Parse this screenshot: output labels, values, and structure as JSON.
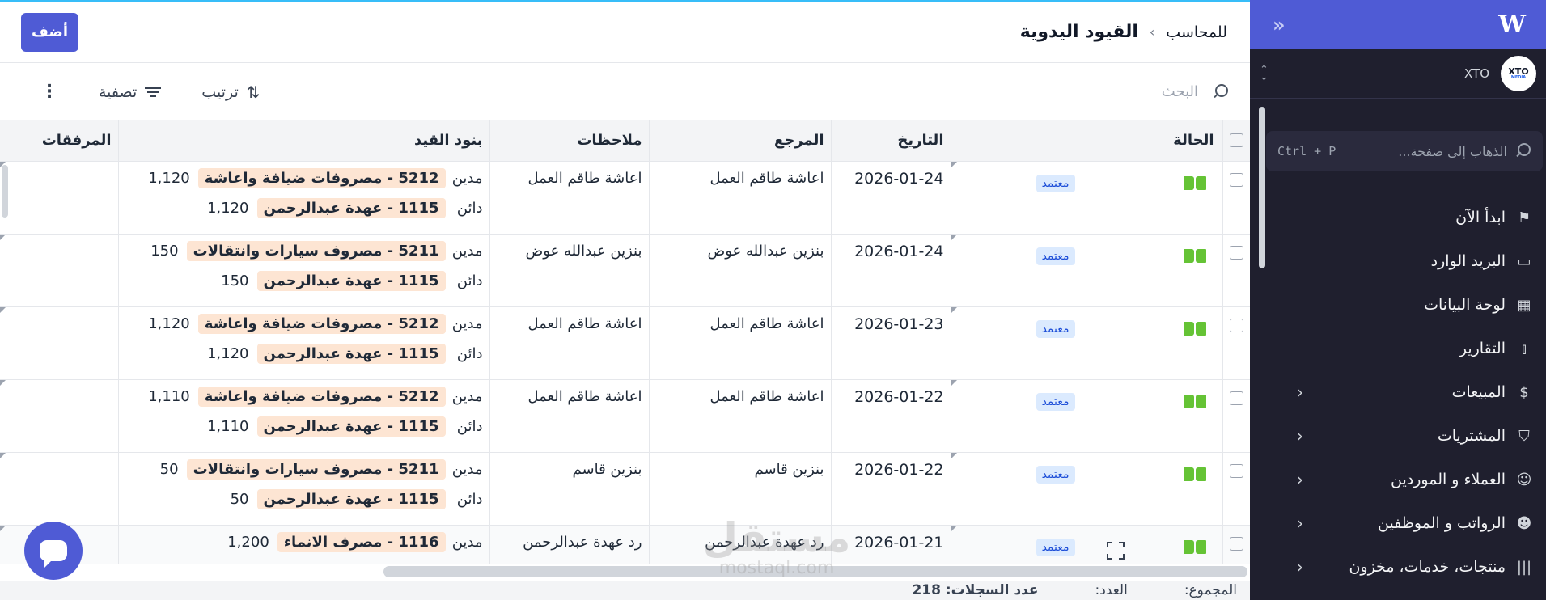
{
  "sidebar": {
    "brand_logo": "W",
    "company_name": "XTO",
    "company_logo_text": "XTO",
    "company_logo_sub": "MEDIA",
    "search_placeholder": "الذهاب إلى صفحة...",
    "search_shortcut": "Ctrl + P",
    "items": [
      {
        "label": "ابدأ الآن",
        "icon": "flag-icon",
        "has_children": false
      },
      {
        "label": "البريد الوارد",
        "icon": "inbox-icon",
        "has_children": false
      },
      {
        "label": "لوحة البيانات",
        "icon": "dashboard-icon",
        "has_children": false
      },
      {
        "label": "التقارير",
        "icon": "chart-bars-icon",
        "has_children": false
      },
      {
        "label": "المبيعات",
        "icon": "dollar-circle-icon",
        "has_children": true
      },
      {
        "label": "المشتريات",
        "icon": "shopping-bag-icon",
        "has_children": true
      },
      {
        "label": "العملاء و الموردين",
        "icon": "users-icon",
        "has_children": true
      },
      {
        "label": "الرواتب و الموظفين",
        "icon": "user-money-icon",
        "has_children": true
      },
      {
        "label": "منتجات، خدمات، مخزون",
        "icon": "barcode-icon",
        "has_children": true
      }
    ]
  },
  "header": {
    "breadcrumb_parent": "للمحاسب",
    "breadcrumb_separator": "›",
    "title": "القيود اليدوية",
    "add_label": "أضف"
  },
  "toolbar": {
    "search_placeholder": "البحث",
    "sort_label": "ترتيب",
    "filter_label": "تصفية"
  },
  "table": {
    "columns": [
      "الحالة",
      "التاريخ",
      "المرجع",
      "ملاحظات",
      "بنود القيد",
      "المرفقات"
    ],
    "rows": [
      {
        "status": "معتمد",
        "date": "2026-01-24",
        "reference": "اعاشة طاقم العمل",
        "notes": "اعاشة طاقم العمل",
        "lines": [
          {
            "type": "مدين",
            "account": "5212 - مصروفات ضيافة واعاشة",
            "amount": "1,120"
          },
          {
            "type": "دائن",
            "account": "1115 - عهدة عبدالرحمن",
            "amount": "1,120"
          }
        ]
      },
      {
        "status": "معتمد",
        "date": "2026-01-24",
        "reference": "بنزين عبدالله عوض",
        "notes": "بنزين عبدالله عوض",
        "lines": [
          {
            "type": "مدين",
            "account": "5211 - مصروف سيارات وانتقالات",
            "amount": "150"
          },
          {
            "type": "دائن",
            "account": "1115 - عهدة عبدالرحمن",
            "amount": "150"
          }
        ]
      },
      {
        "status": "معتمد",
        "date": "2026-01-23",
        "reference": "اعاشة طاقم العمل",
        "notes": "اعاشة طاقم العمل",
        "lines": [
          {
            "type": "مدين",
            "account": "5212 - مصروفات ضيافة واعاشة",
            "amount": "1,120"
          },
          {
            "type": "دائن",
            "account": "1115 - عهدة عبدالرحمن",
            "amount": "1,120"
          }
        ]
      },
      {
        "status": "معتمد",
        "date": "2026-01-22",
        "reference": "اعاشة طاقم العمل",
        "notes": "اعاشة طاقم العمل",
        "lines": [
          {
            "type": "مدين",
            "account": "5212 - مصروفات ضيافة واعاشة",
            "amount": "1,110"
          },
          {
            "type": "دائن",
            "account": "1115 - عهدة عبدالرحمن",
            "amount": "1,110"
          }
        ]
      },
      {
        "status": "معتمد",
        "date": "2026-01-22",
        "reference": "بنزين قاسم",
        "notes": "بنزين قاسم",
        "lines": [
          {
            "type": "مدين",
            "account": "5211 - مصروف سيارات وانتقالات",
            "amount": "50"
          },
          {
            "type": "دائن",
            "account": "1115 - عهدة عبدالرحمن",
            "amount": "50"
          }
        ]
      },
      {
        "status": "معتمد",
        "date": "2026-01-21",
        "reference": "رد عهدة عبدالرحمن",
        "notes": "رد عهدة عبدالرحمن",
        "lines": [
          {
            "type": "مدين",
            "account": "1116 - مصرف الانماء",
            "amount": "1,200"
          }
        ]
      }
    ]
  },
  "footer": {
    "total_label": "المجموع:",
    "count_label": "العدد:",
    "records_label": "عدد السجلات: 218"
  },
  "watermark": {
    "text": "مستقل",
    "sub": "mostaql.com"
  },
  "colors": {
    "accent": "#4f5bd5",
    "sidebar_bg": "#1f1f2e",
    "badge_bg": "#dbeafe",
    "badge_text": "#1d4ed8",
    "account_tag_bg": "#fde5d3",
    "book_icon": "#65c335"
  }
}
